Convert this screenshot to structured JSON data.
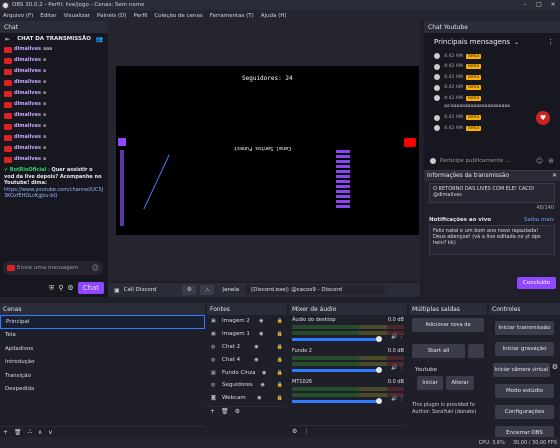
{
  "window": {
    "title": "OBS 30.0.2 - Perfil: live/jogo - Cenas: Sem nome"
  },
  "menu": [
    "Arquivo (F)",
    "Editar",
    "Visualizar",
    "Painéis (D)",
    "Perfil",
    "Coleção de cenas",
    "Ferramentas (T)",
    "Ajuda (H)"
  ],
  "chat_left": {
    "panel_title": "Chat",
    "header": "CHAT DA TRANSMISSÃO",
    "messages": [
      {
        "user": "dimalives",
        "text": "aaa"
      },
      {
        "user": "dimalives",
        "text": "a"
      },
      {
        "user": "dimalives",
        "text": "a"
      },
      {
        "user": "dimalives",
        "text": "a"
      },
      {
        "user": "dimalives",
        "text": "a"
      },
      {
        "user": "dimalives",
        "text": "a"
      },
      {
        "user": "dimalives",
        "text": "a"
      },
      {
        "user": "dimalives",
        "text": "a"
      },
      {
        "user": "dimalives",
        "text": "a"
      },
      {
        "user": "dimalives",
        "text": "a"
      },
      {
        "user": "dimalives",
        "text": "a"
      }
    ],
    "bot": {
      "user": "BotRioOficial",
      "text": "Quer assistir o vod da live depois? Acompanhe no Youtube! dima:",
      "link": "https://www.youtube.com/channel/UC5J3KOzfEHDLcKgJzu-bQ"
    },
    "input_placeholder": "Envie uma mensagem",
    "chat_button": "Chat"
  },
  "preview": {
    "counter": "Seguidores: 24",
    "caption": "Canal Santos Funest"
  },
  "source_toolbar": {
    "source_name": "Call Discord",
    "window_label": "Janela",
    "window_value": "[Discord.exe]: @cacos9 - Discord"
  },
  "chat_right": {
    "panel_title": "Chat Youtube",
    "header": "Principais mensagens",
    "messages": [
      {
        "time": "4:42 AM",
        "badge": "dima"
      },
      {
        "time": "4:42 AM",
        "badge": "dima"
      },
      {
        "time": "4:42 AM",
        "badge": "dima"
      },
      {
        "time": "4:42 AM",
        "badge": "dima"
      },
      {
        "time": "4:42 AM",
        "badge": "dima"
      },
      {
        "time": "4:42 AM",
        "badge": "dima"
      },
      {
        "time": "4:42 AM",
        "badge": "dima"
      }
    ],
    "aa_text": "aa'aaaaaaaaaaaaaaaaaaaaa",
    "input_placeholder": "Participe publicamente ..."
  },
  "info": {
    "title": "Informações da transmissão",
    "stream_title": "O RETORNO DAS LIVES COM ELE! CACO! @dimalives",
    "counter": "48/140",
    "notif_label": "Notificações ao vivo",
    "notif_link": "Saiba mais",
    "notif_text": "Feliz natal e um bom ano novo rapaziada! Deus abençoe! (vá a live editada no yt dps hein? kk)",
    "done_button": "Concluído"
  },
  "scenes": {
    "title": "Cenas",
    "items": [
      "Principal",
      "Tela",
      "Apiladivos",
      "Introdução",
      "Transição",
      "Despedida"
    ]
  },
  "sources": {
    "title": "Fontes",
    "items": [
      "Imagem 2",
      "Imagem 1",
      "Chat 2",
      "Chat 4",
      "Fundo Cinza",
      "Seguidores",
      "Webcam"
    ]
  },
  "mixer": {
    "title": "Mixer de áudio",
    "channels": [
      {
        "name": "Áudio do desktop",
        "db": "0.0 dB"
      },
      {
        "name": "Fundo 2",
        "db": "0.0 dB"
      },
      {
        "name": "MT1026",
        "db": "0.0 dB"
      }
    ]
  },
  "multi": {
    "title": "Múltiplas saídas",
    "add_button": "Adicionar nova de",
    "start_all": "Start all",
    "youtube_label": "Youtube",
    "start_btn": "Iniciar",
    "change_btn": "Alterar",
    "note": "This plugin is provided fo Author: SoraYuki (donate)"
  },
  "controls": {
    "title": "Controles",
    "buttons": [
      "Iniciar transmissão",
      "Iniciar gravação",
      "Iniciar câmera virtual",
      "Modo estúdio",
      "Configurações",
      "Encerrar OBS"
    ]
  },
  "status": {
    "cpu": "CPU: 3,6%",
    "fps": "30,00 / 30,00 FPS",
    "time": "00:00:00"
  }
}
